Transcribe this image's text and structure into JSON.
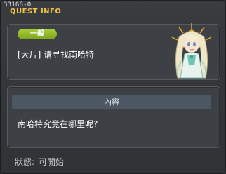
{
  "window": {
    "quest_id": "33168-0",
    "title": "QUEST INFO"
  },
  "quest": {
    "category": "一般",
    "name": "[大片] 请寻找南哈特"
  },
  "content": {
    "header": "內容",
    "text": "南哈特究竟在哪里呢?"
  },
  "status": {
    "label": "狀態:",
    "value": "可開始"
  },
  "icons": {
    "npc": "npc-goddess-icon"
  },
  "colors": {
    "title": "#f2c24a",
    "tag": "#8fb82a",
    "content_header": "#4b5864"
  }
}
